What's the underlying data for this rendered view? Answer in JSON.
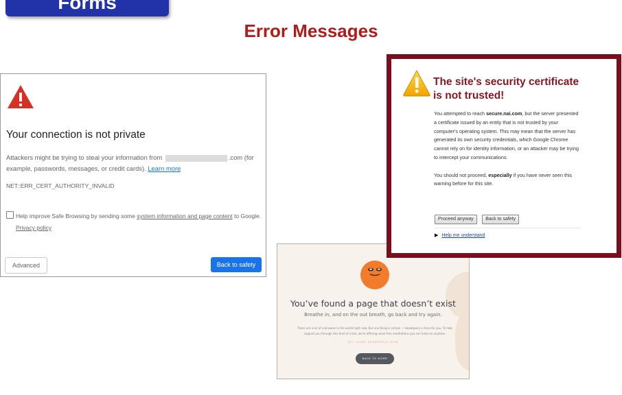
{
  "slide": {
    "tab_label": "Forms",
    "title": "Error Messages"
  },
  "chrome_privacy": {
    "icon": "warning-triangle-icon",
    "heading": "Your connection is not private",
    "body_prefix": "Attackers might be trying to steal your information from",
    "body_domain": ".com",
    "body_suffix": "(for example, passwords, messages, or credit cards).",
    "learn_more": "Learn more",
    "error_code": "NET::ERR_CERT_AUTHORITY_INVALID",
    "checkbox_prefix": "Help improve Safe Browsing by sending some",
    "checkbox_link": "system information and page content",
    "checkbox_suffix": "to Google.",
    "privacy_policy": "Privacy policy",
    "advanced_button": "Advanced",
    "back_button": "Back to safety",
    "accent": "#1a73e8",
    "warning_color": "#d93025"
  },
  "not_found": {
    "heading": "You’ve found a page that doesn’t exist",
    "subheading": "Breathe in, and on the out breath, go back and try again.",
    "small_text": "There are a lot of unknowns in the world right now. But one thing is certain — Headspace is here for you. To help support you through this time of crisis, we're offering some free meditations you can listen to anytime.",
    "link_text": "GET SOME HEADSPACE NOW",
    "button": "BACK TO HOME",
    "character_color": "#f27c2c",
    "background": "#f7f2ec"
  },
  "cert_warning": {
    "icon": "warning-triangle-icon",
    "title": "The site's security certificate is not trusted!",
    "p1_a": "You attempted to reach",
    "p1_site": "secure.nai.com",
    "p1_b": ", but the server presented a certificate issued by an entity that is not trusted by your computer's operating system. This may mean that the server has generated its own security credentials, which Google Chrome cannot rely on for identity information, or an attacker may be trying to intercept your communications.",
    "p2_a": "You should not proceed,",
    "p2_bold": "especially",
    "p2_b": "if you have never seen this warning before for this site.",
    "proceed_button": "Proceed anyway",
    "back_button": "Back to safety",
    "help_link": "Help me understand",
    "border_color": "#7a0e1f",
    "title_color": "#8b1722"
  }
}
